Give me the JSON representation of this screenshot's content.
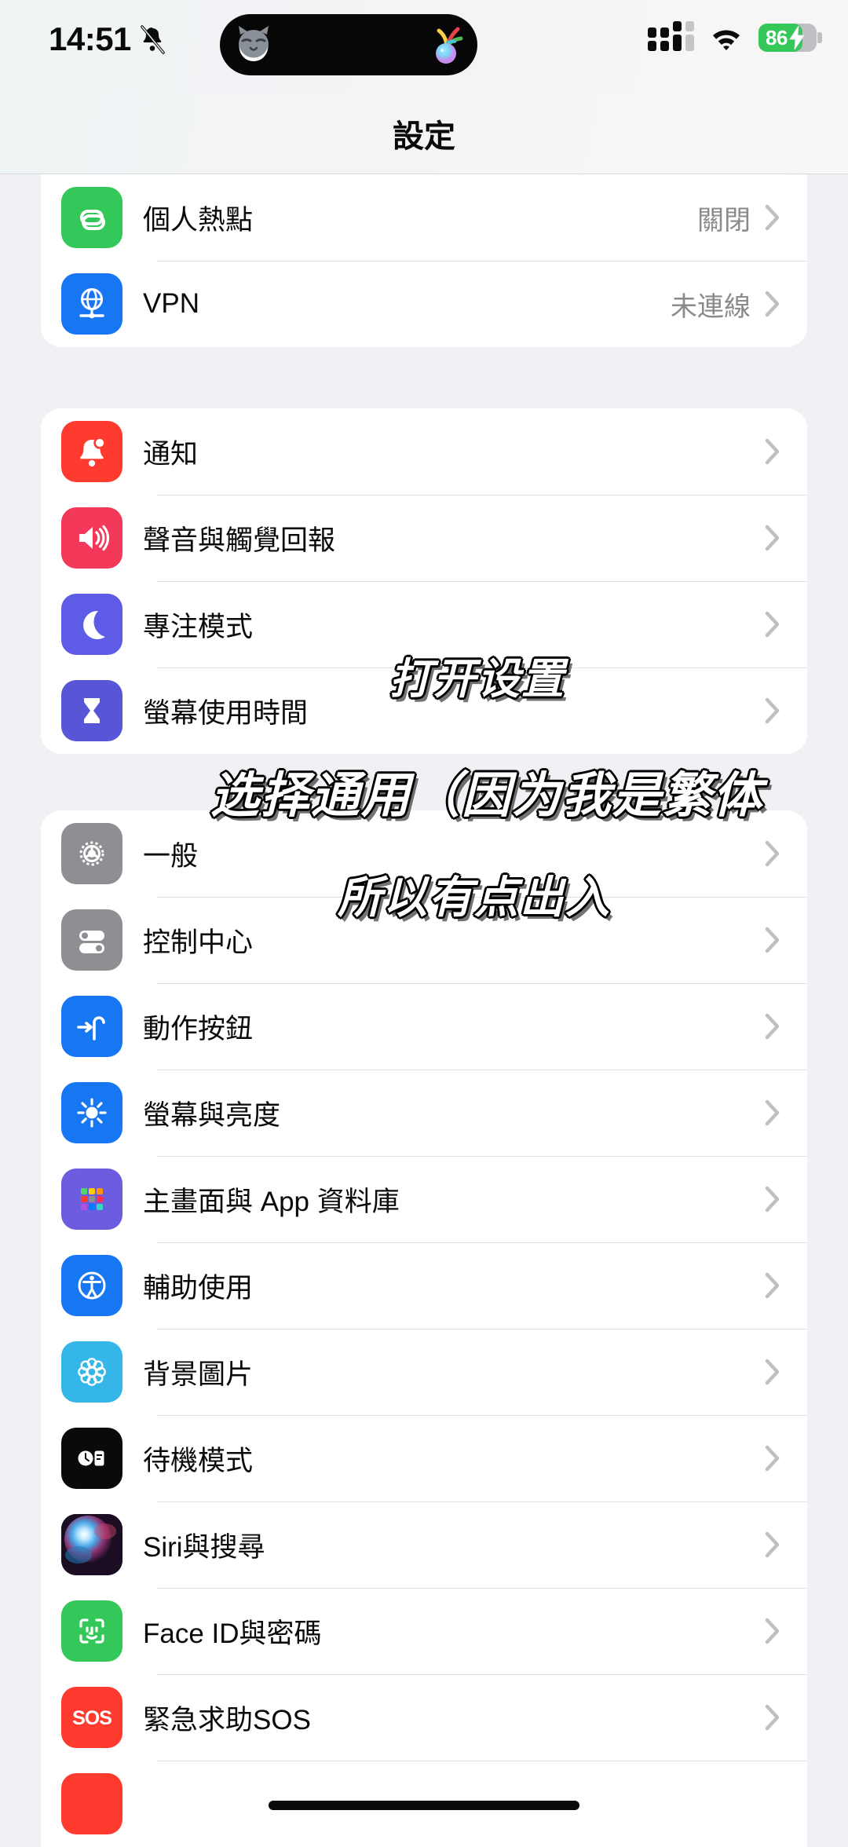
{
  "status_bar": {
    "time": "14:51",
    "silent_icon": "bell-slash-icon",
    "island_left_icon": "cat-face-icon",
    "island_right_icon": "fruit-plant-icon",
    "signal_icon": "cellular-signal-icon",
    "wifi_icon": "wifi-icon",
    "battery_percent": "86",
    "battery_charging": true
  },
  "nav": {
    "title": "設定"
  },
  "sections": [
    {
      "id": "connectivity",
      "partial_top": true,
      "rows": [
        {
          "label": "個人熱點",
          "value": "關閉",
          "icon": "personal-hotspot-icon",
          "color": "#34C759"
        },
        {
          "label": "VPN",
          "value": "未連線",
          "icon": "vpn-globe-icon",
          "color": "#1777F2"
        }
      ]
    },
    {
      "id": "alerts",
      "rows": [
        {
          "label": "通知",
          "value": "",
          "icon": "notifications-bell-icon",
          "color": "#FF3B30"
        },
        {
          "label": "聲音與觸覺回報",
          "value": "",
          "icon": "sounds-haptics-icon",
          "color": "#F4385A"
        },
        {
          "label": "專注模式",
          "value": "",
          "icon": "focus-moon-icon",
          "color": "#5E5CE6"
        },
        {
          "label": "螢幕使用時間",
          "value": "",
          "icon": "screen-time-hourglass-icon",
          "color": "#5856D6"
        }
      ]
    },
    {
      "id": "system",
      "partial_bottom": true,
      "rows": [
        {
          "label": "一般",
          "value": "",
          "icon": "general-gear-icon",
          "color": "#8E8E93"
        },
        {
          "label": "控制中心",
          "value": "",
          "icon": "control-center-toggles-icon",
          "color": "#8E8E93"
        },
        {
          "label": "動作按鈕",
          "value": "",
          "icon": "action-button-icon",
          "color": "#1777F2"
        },
        {
          "label": "螢幕與亮度",
          "value": "",
          "icon": "display-brightness-sun-icon",
          "color": "#1777F2"
        },
        {
          "label": "主畫面與 App 資料庫",
          "value": "",
          "icon": "home-screen-app-library-icon",
          "color": "#6C5CE0"
        },
        {
          "label": "輔助使用",
          "value": "",
          "icon": "accessibility-icon",
          "color": "#1777F2"
        },
        {
          "label": "背景圖片",
          "value": "",
          "icon": "wallpaper-flower-icon",
          "color": "#35B6E8"
        },
        {
          "label": "待機模式",
          "value": "",
          "icon": "standby-clock-icon",
          "color": "#0A0A0A"
        },
        {
          "label": "Siri與搜尋",
          "value": "",
          "icon": "siri-orb-icon",
          "color": "#2A1230"
        },
        {
          "label": "Face ID與密碼",
          "value": "",
          "icon": "face-id-icon",
          "color": "#34C759"
        },
        {
          "label": "緊急求助SOS",
          "value": "",
          "icon": "emergency-sos-icon",
          "color": "#FF3B30"
        }
      ]
    }
  ],
  "annotations": [
    {
      "id": "ov1",
      "text": "打开设置"
    },
    {
      "id": "ov2",
      "text": "选择通用（因为我是繁体"
    },
    {
      "id": "ov3",
      "text": "所以有点出入"
    }
  ],
  "chevron_icon": "chevron-right-icon",
  "home_indicator": "home-indicator-bar"
}
